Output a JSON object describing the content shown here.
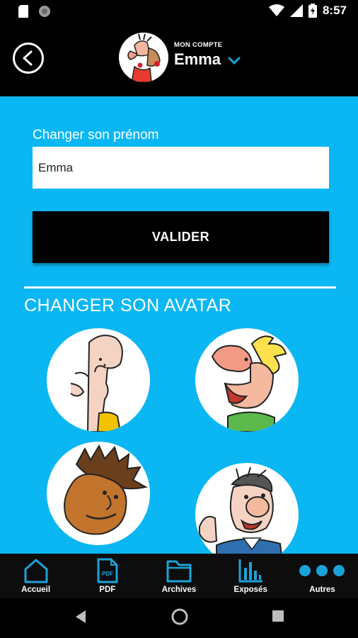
{
  "status_bar": {
    "time": "8:57"
  },
  "header": {
    "account_caption": "MON COMPTE",
    "account_name": "Emma"
  },
  "form": {
    "label": "Changer son prénom",
    "input_value": "Emma",
    "submit_label": "VALIDER"
  },
  "avatars": {
    "title": "CHANGER SON AVATAR"
  },
  "bottom_nav": {
    "items": [
      {
        "label": "Accueil",
        "icon": "home-icon"
      },
      {
        "label": "PDF",
        "icon": "pdf-file-icon"
      },
      {
        "label": "Archives",
        "icon": "folder-icon"
      },
      {
        "label": "Exposés",
        "icon": "bar-chart-icon"
      },
      {
        "label": "Autres",
        "icon": "more-dots-icon"
      }
    ],
    "pdf_icon_text": "PDF"
  },
  "colors": {
    "accent_blue": "#0ab7f3",
    "nav_icon_blue": "#1aa3d9",
    "background_dark": "#000000"
  }
}
